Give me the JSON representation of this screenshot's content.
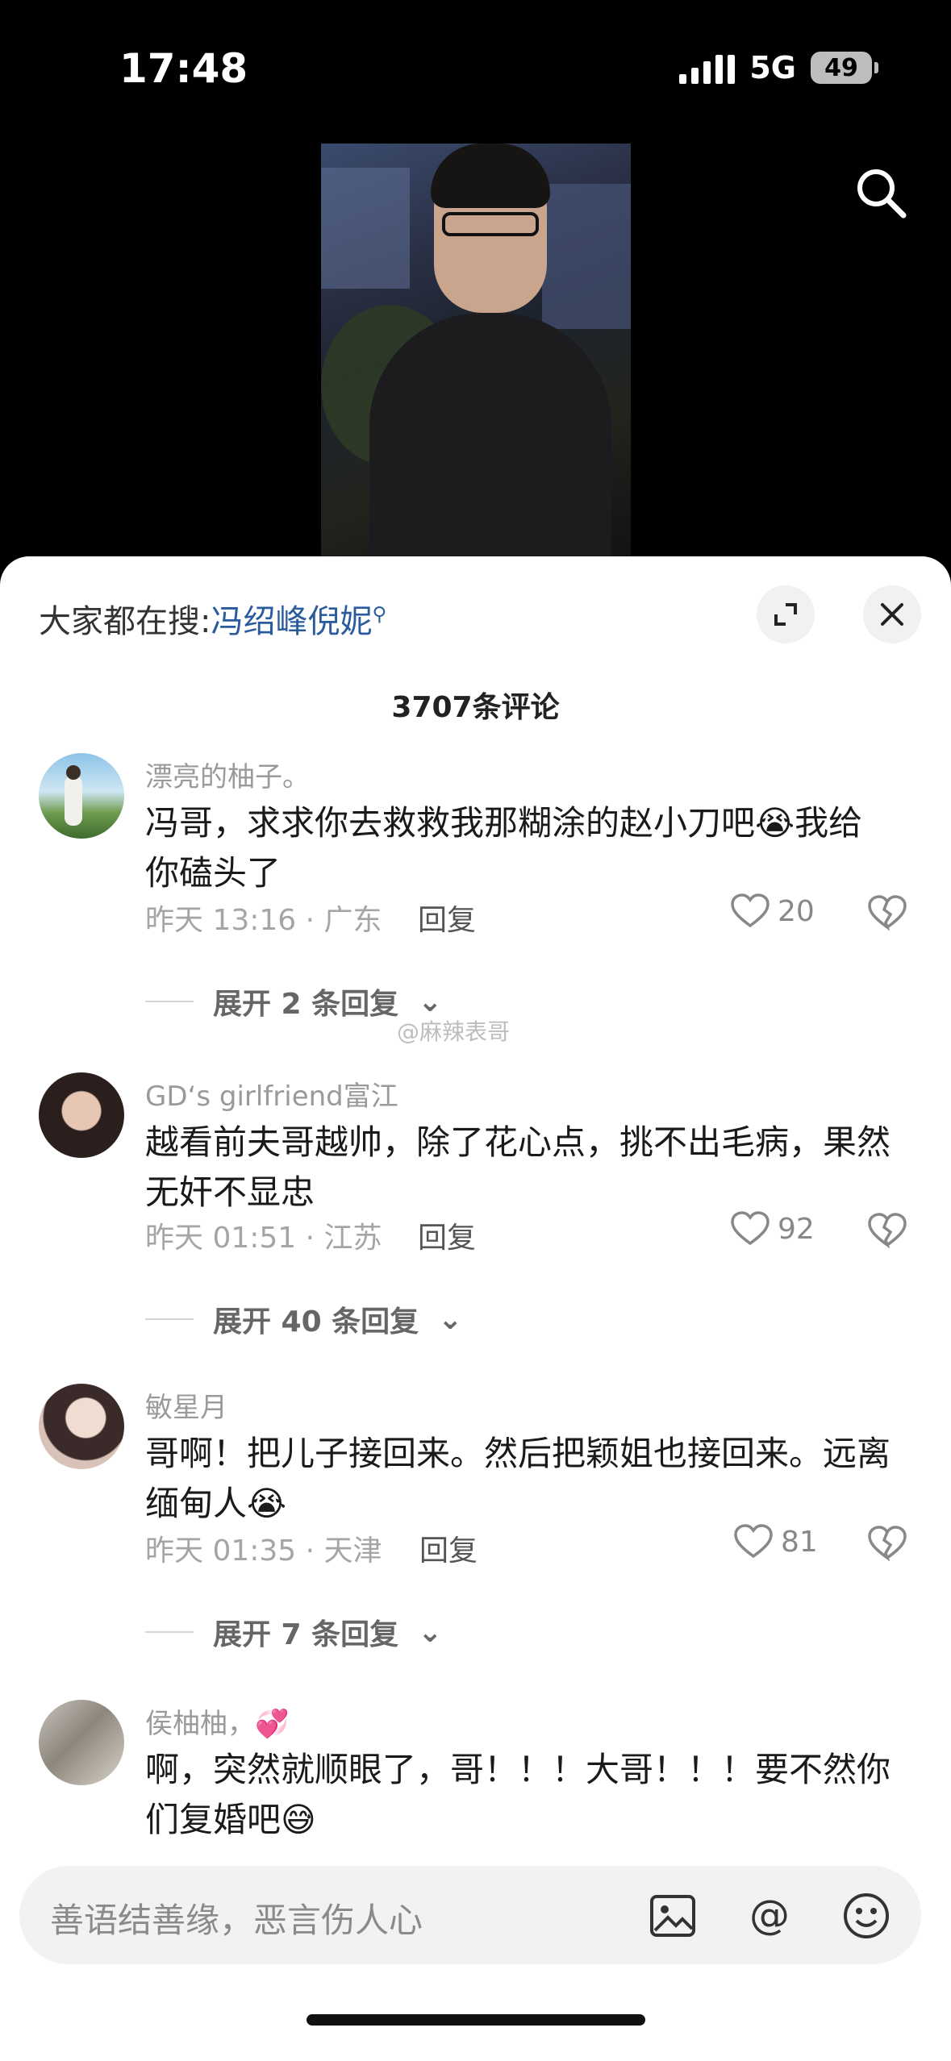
{
  "status": {
    "time": "17:48",
    "network": "5G",
    "battery": "49"
  },
  "sheet": {
    "hot_prefix": "大家都在搜:",
    "hot_keyword": "冯绍峰倪妮",
    "comment_count": "3707条评论",
    "watermark": "@麻辣表哥"
  },
  "comments": [
    {
      "user": "漂亮的柚子。",
      "text": "冯哥，求求你去救救我那糊涂的赵小刀吧😭我给你磕头了",
      "meta": "昨天 13:16 · 广东",
      "reply": "回复",
      "likes": "20",
      "expand": "展开 2 条回复"
    },
    {
      "user": "GD‘s girlfriend富江",
      "text": "越看前夫哥越帅，除了花心点，挑不出毛病，果然无奸不显忠",
      "meta": "昨天 01:51 · 江苏",
      "reply": "回复",
      "likes": "92",
      "expand": "展开 40 条回复"
    },
    {
      "user": "敏星月",
      "text": "哥啊！把儿子接回来。然后把颖姐也接回来。远离缅甸人😭",
      "meta": "昨天 01:35 · 天津",
      "reply": "回复",
      "likes": "81",
      "expand": "展开 7 条回复"
    },
    {
      "user": "侯柚柚，💞",
      "text": "啊，突然就顺眼了，哥！！！大哥！！！要不然你们复婚吧😅"
    }
  ],
  "input": {
    "placeholder": "善语结善缘，恶言伤人心"
  },
  "icons": {
    "search": "search-icon",
    "expand": "expand-icon",
    "close": "close-icon",
    "heart": "heart-icon",
    "broken_heart": "broken-heart-icon",
    "image": "image-icon",
    "mention": "at-icon",
    "emoji": "emoji-icon"
  }
}
